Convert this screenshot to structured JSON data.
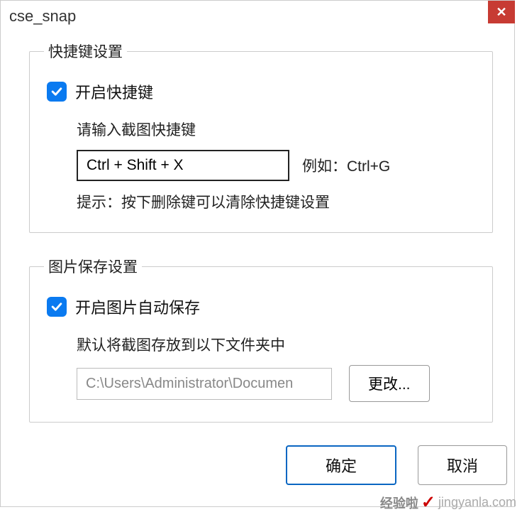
{
  "window": {
    "title": "cse_snap"
  },
  "hotkey": {
    "legend": "快捷键设置",
    "enable_label": "开启快捷键",
    "enable_checked": true,
    "input_label": "请输入截图快捷键",
    "input_value": "Ctrl + Shift + X",
    "example": "例如：Ctrl+G",
    "hint": "提示：按下删除键可以清除快捷键设置"
  },
  "save": {
    "legend": "图片保存设置",
    "enable_label": "开启图片自动保存",
    "enable_checked": true,
    "path_label": "默认将截图存放到以下文件夹中",
    "path_value": "C:\\Users\\Administrator\\Documen",
    "change_label": "更改..."
  },
  "buttons": {
    "ok": "确定",
    "cancel": "取消"
  },
  "watermark": {
    "brand": "经验啦",
    "site": "jingyanla.com"
  }
}
